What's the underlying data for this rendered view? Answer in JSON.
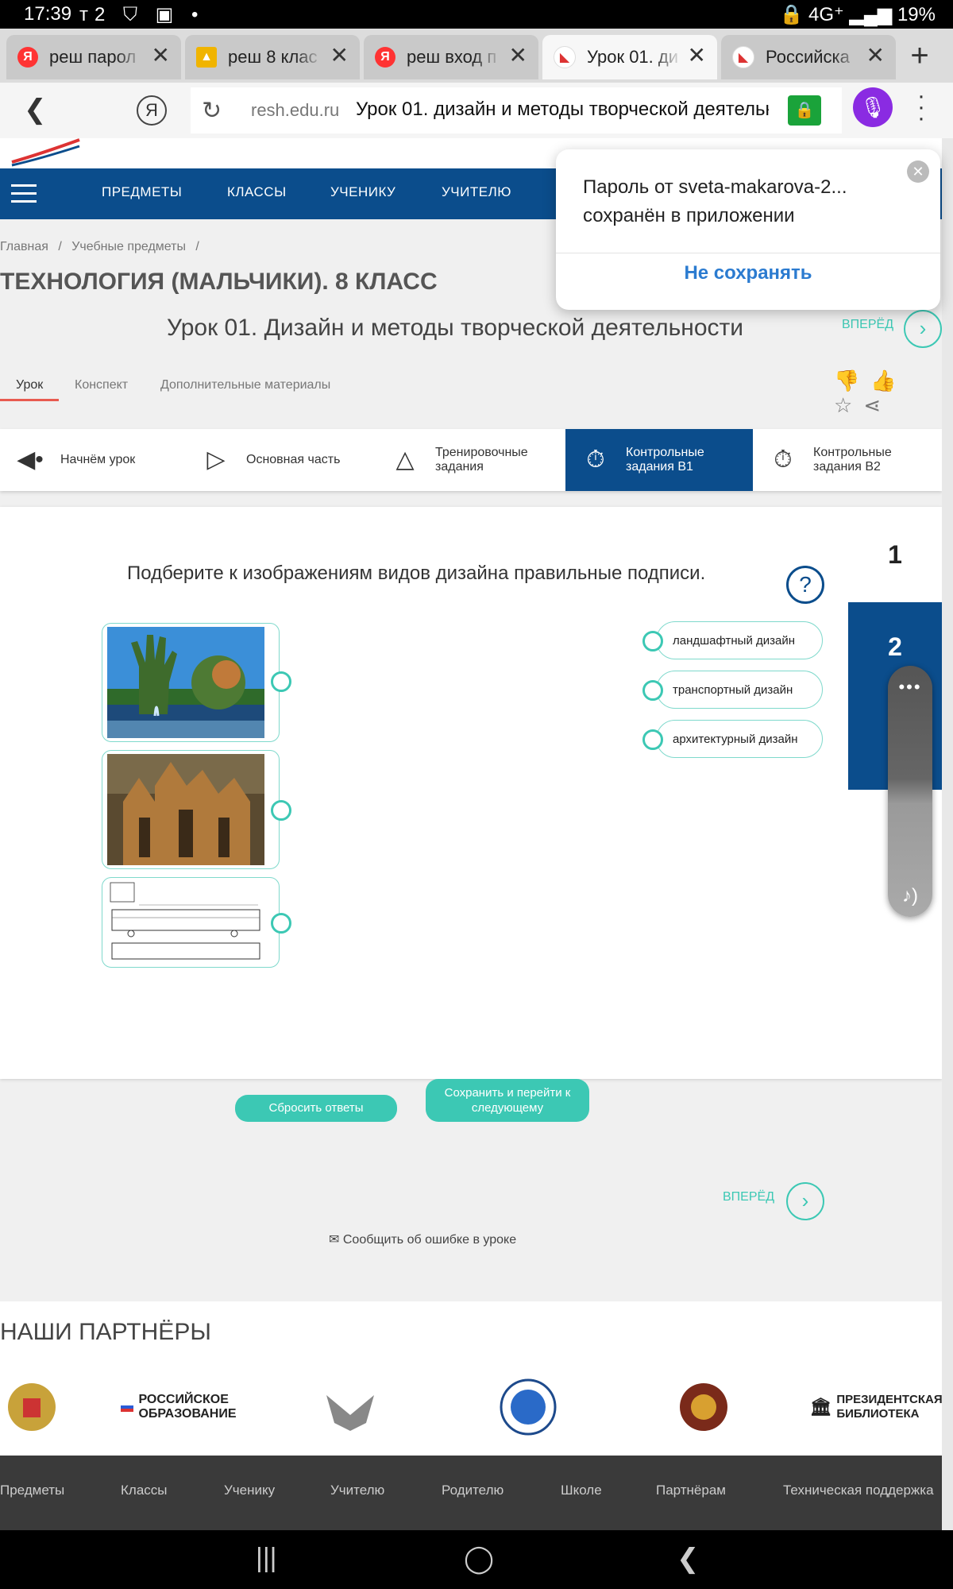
{
  "status": {
    "time": "17:39",
    "left_icons": "ᴛ2 ⛉ ▣ •",
    "right_icons": "🔒 4G⁺ ▂▄▆",
    "battery": "19%"
  },
  "tabs": [
    {
      "title": "реш парол",
      "fav_color": "#f33"
    },
    {
      "title": "реш 8 клас",
      "fav_color": "#f0b400"
    },
    {
      "title": "реш вход п",
      "fav_color": "#f33"
    },
    {
      "title": "Урок 01. ди",
      "fav_color": "#d33"
    },
    {
      "title": "Российска",
      "fav_color": "#d33"
    }
  ],
  "address": {
    "domain": "resh.edu.ru",
    "title": "Урок 01. дизайн и методы творческой деятельнос"
  },
  "nav": {
    "items": [
      "ПРЕДМЕТЫ",
      "КЛАССЫ",
      "УЧЕНИКУ",
      "УЧИТЕЛЮ"
    ]
  },
  "breadcrumb": [
    "Главная",
    "/",
    "Учебные предметы",
    "/"
  ],
  "subject_title": "ТЕХНОЛОГИЯ (МАЛЬЧИКИ). 8 КЛАСС",
  "lesson_title": "Урок 01. Дизайн и методы творческой деятельности",
  "forward_label": "ВПЕРЁД",
  "subtabs": [
    "Урок",
    "Конспект",
    "Дополнительные материалы"
  ],
  "stages": [
    {
      "label": "Начнём урок",
      "icon": "megaphone-icon"
    },
    {
      "label": "Основная часть",
      "icon": "play-icon"
    },
    {
      "label": "Тренировочные\nзадания",
      "icon": "pyramid-icon"
    },
    {
      "label": "Контрольные\nзадания В1",
      "icon": "timer-icon"
    },
    {
      "label": "Контрольные\nзадания В2",
      "icon": "timer-icon"
    }
  ],
  "task": {
    "question": "Подберите к изображениям видов дизайна правильные подписи.",
    "help_icon": "?",
    "pages": [
      "1",
      "2"
    ],
    "options": [
      "ландшафтный дизайн",
      "транспортный дизайн",
      "архитектурный дизайн"
    ],
    "images": [
      "hand-sculpture-fountain-image",
      "gothic-cathedral-image",
      "train-blueprint-image"
    ],
    "reset_label": "Сбросить ответы",
    "save_label": "Сохранить и перейти к следующему",
    "report_label": "Сообщить об ошибке в уроке"
  },
  "popup": {
    "text": "Пароль от sveta-makarova-2... сохранён в приложении",
    "button": "Не сохранять"
  },
  "partners": {
    "title": "НАШИ ПАРТНЁРЫ",
    "items": [
      "РОССИЙСКОЕ\nОБРАЗОВАНИЕ",
      "ПРЕЗИДЕНТСКАЯ\nБИБЛИОТЕКА"
    ]
  },
  "footer": [
    "Предметы",
    "Классы",
    "Ученику",
    "Учителю",
    "Родителю",
    "Школе",
    "Партнёрам",
    "Техническая поддержка"
  ],
  "colors": {
    "brand": "#0b4d8c",
    "accent": "#3cc8b4"
  }
}
